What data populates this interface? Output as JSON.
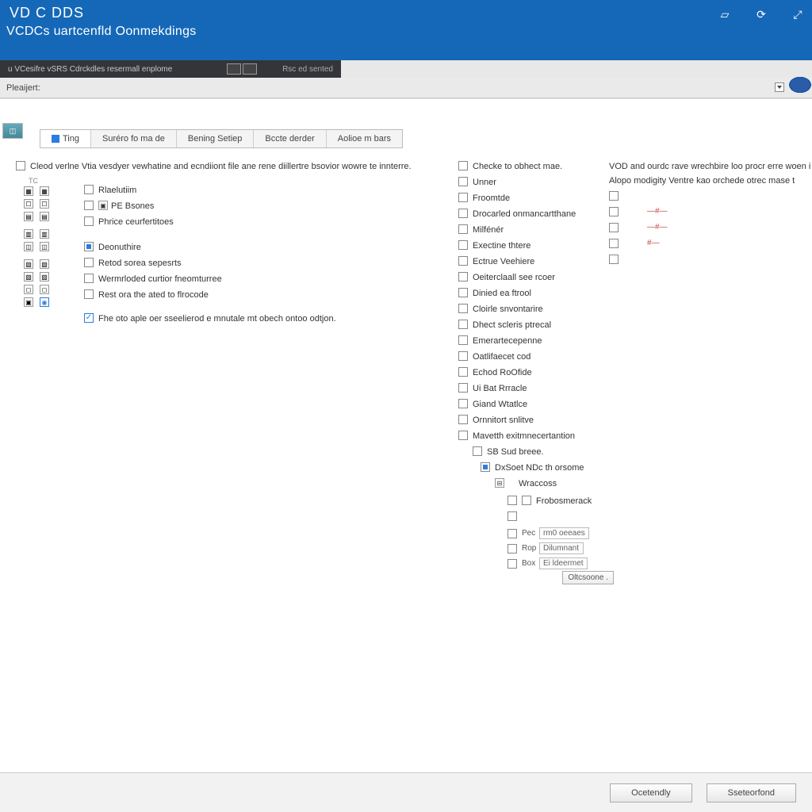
{
  "header": {
    "title": "VD C DDS",
    "subtitle": "VCDCs uartcenfld Oonmekdings"
  },
  "tabstrip": {
    "text": "u VCesifre vSRS Cdrckdles resermall enplome",
    "right": "Rsc ed sented"
  },
  "toolbar": {
    "label": "Pleaijert:"
  },
  "tabs": [
    {
      "label": "Ting",
      "active": true
    },
    {
      "label": "Suréro fo ma de",
      "active": false
    },
    {
      "label": "Bening Setiep",
      "active": false
    },
    {
      "label": "Bccte derder",
      "active": false
    },
    {
      "label": "Aolioe m bars",
      "active": false
    }
  ],
  "left": {
    "top_line": "Cleod verlne Vtia vesdyer vewhatine and ecndiiont file ane rene diillertre bsovior wowre te innterre.",
    "tc_label": "TC",
    "items1": [
      {
        "label": "Rlaelutiim",
        "icon": true
      },
      {
        "label": "PE Bsones",
        "icon": true,
        "pre": "☒"
      },
      {
        "label": "Phrice ceurfertitoes",
        "icon": false
      }
    ],
    "items2": [
      {
        "label": "Deonuthire",
        "checked": true
      },
      {
        "label": "Retod sorea sepesrts"
      },
      {
        "label": "Wermrloded curtior fneomturree"
      },
      {
        "label": "Rest ora the ated to flrocode"
      }
    ],
    "note": "Fhe oto aple oer sseelierod e mnutale mt obech ontoo odtjon."
  },
  "mid": {
    "header": "Checke to obhect mae.",
    "items": [
      "Unner",
      "Froomtde",
      "Drocarled onmancartthane",
      "Milfénér",
      "Exectine thtere",
      "Ectrue Veehiere",
      "Oeiterclaall see rcoer",
      "Dinied ea ftrool",
      "Cloirle snvontarire",
      "Dhect scleris ptrecal",
      "Emerartecepenne",
      "Oatlifaecet cod",
      "Echod RoOfide",
      "Ui Bat Rrracle",
      "Giand Wtatlce",
      "Ornnitort snlitve",
      "Mavetth exitmnecertantion"
    ],
    "sub_header": "SB Sud breee.",
    "sub_item": "DxSoet NDc th orsome",
    "sub_label": "Wraccoss",
    "sub_check": "Frobosmerack",
    "fields": [
      {
        "lbl": "Pec",
        "val": "rm0 oeeaes"
      },
      {
        "lbl": "Rop",
        "val": "Dilumnant"
      },
      {
        "lbl": "Box",
        "val": "Ei ldeermet"
      }
    ],
    "btn": "Oltcsoone ."
  },
  "right": {
    "line1": "VOD and ourdc rave wrechbire loo procr erre woen i",
    "line2": "Alopo modigity Ventre kao orchede otrec mase t",
    "marks": [
      "—#—",
      "—#—",
      "#—"
    ]
  },
  "footer": {
    "btn1": "Ocetendly",
    "btn2": "Sseteorfond"
  }
}
